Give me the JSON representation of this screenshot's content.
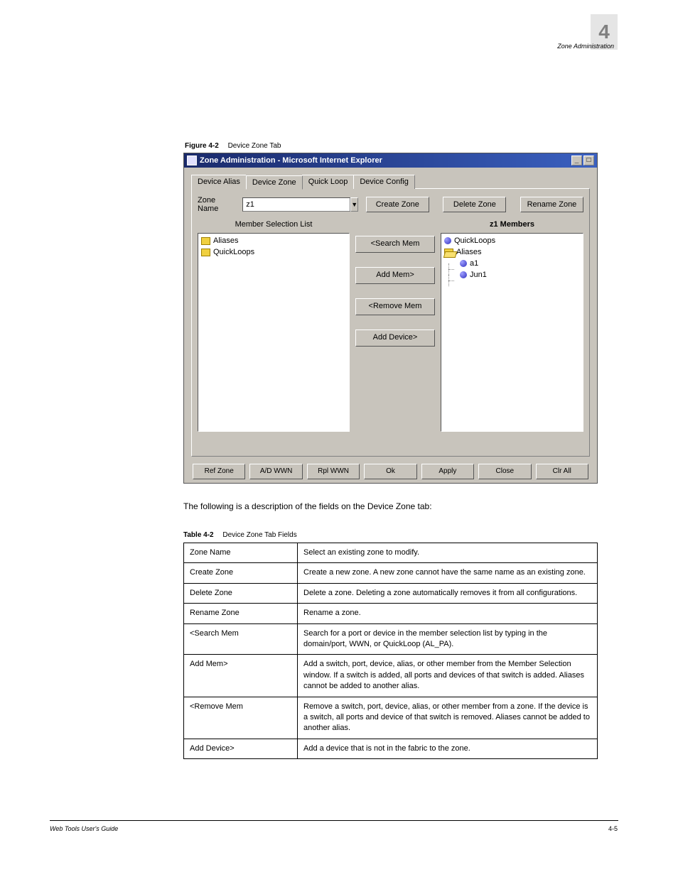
{
  "header": {
    "chapter_number": "4",
    "chapter_title": "Zone Administration"
  },
  "figure": {
    "label": "Figure 4-2",
    "caption": "Device Zone Tab"
  },
  "window": {
    "title": "Zone Administration - Microsoft Internet Explorer",
    "min_icon": "_",
    "max_icon": "□"
  },
  "tabs": [
    "Device Alias",
    "Device Zone",
    "Quick Loop",
    "Device Config"
  ],
  "active_tab_index": 1,
  "zone_row": {
    "label": "Zone Name",
    "value": "z1",
    "buttons": {
      "create": "Create Zone",
      "delete": "Delete Zone",
      "rename": "Rename Zone"
    }
  },
  "left_col": {
    "title": "Member Selection List",
    "items": [
      "Aliases",
      "QuickLoops"
    ]
  },
  "mid_buttons": {
    "search": "<Search Mem",
    "add_mem": "Add Mem>",
    "remove_mem": "<Remove Mem",
    "add_device": "Add Device>"
  },
  "right_col": {
    "title": "z1 Members",
    "items": [
      {
        "type": "ball",
        "label": "QuickLoops",
        "indent": 0
      },
      {
        "type": "folder-open",
        "label": "Aliases",
        "indent": 0
      },
      {
        "type": "ball",
        "label": "a1",
        "indent": 1
      },
      {
        "type": "ball",
        "label": "Jun1",
        "indent": 1
      }
    ]
  },
  "bottom_buttons": [
    "Ref Zone",
    "A/D WWN",
    "Rpl WWN",
    "Ok",
    "Apply",
    "Close",
    "Clr All"
  ],
  "body_text": "The following is a description of the fields on the Device Zone tab:",
  "table_caption": {
    "label": "Table 4-2",
    "caption": "Device Zone Tab Fields"
  },
  "table_rows": [
    {
      "field": "Zone Name",
      "desc": "Select an existing zone to modify."
    },
    {
      "field": "Create Zone",
      "desc": "Create a new zone. A new zone cannot have the same name as an existing zone."
    },
    {
      "field": "Delete Zone",
      "desc": "Delete a zone. Deleting a zone automatically removes it from all configurations."
    },
    {
      "field": "Rename Zone",
      "desc": "Rename a zone."
    },
    {
      "field": "<Search Mem",
      "desc": "Search for a port or device in the member selection list by typing in the domain/port, WWN, or QuickLoop (AL_PA)."
    },
    {
      "field": "Add Mem>",
      "desc": "Add a switch, port, device, alias, or other member from the Member Selection window. If a switch is added, all ports and devices of that switch is added. Aliases cannot be added to another alias."
    },
    {
      "field": "<Remove Mem",
      "desc": "Remove a switch, port, device, alias, or other member from a zone. If the device is a switch, all ports and device of that switch is removed. Aliases cannot be added to another alias."
    },
    {
      "field": "Add Device>",
      "desc": "Add a device that is not in the fabric to the zone."
    }
  ],
  "footer": {
    "left": "Web Tools User's Guide",
    "right": "4-5"
  }
}
